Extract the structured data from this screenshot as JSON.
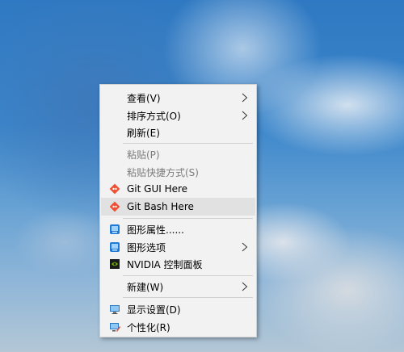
{
  "context_menu": {
    "view": "查看(V)",
    "sort_by": "排序方式(O)",
    "refresh": "刷新(E)",
    "paste": "粘贴(P)",
    "paste_shortcut": "粘贴快捷方式(S)",
    "git_gui": "Git GUI Here",
    "git_bash": "Git Bash Here",
    "graphics_properties": "图形属性......",
    "graphics_options": "图形选项",
    "nvidia_control_panel": "NVIDIA 控制面板",
    "new": "新建(W)",
    "display_settings": "显示设置(D)",
    "personalize": "个性化(R)"
  },
  "colors": {
    "menu_bg": "#f2f2f2",
    "hover_bg": "#e1e1e1",
    "disabled_text": "#7c7c7c",
    "git_orange": "#f05033",
    "nvidia_green": "#76b900"
  }
}
